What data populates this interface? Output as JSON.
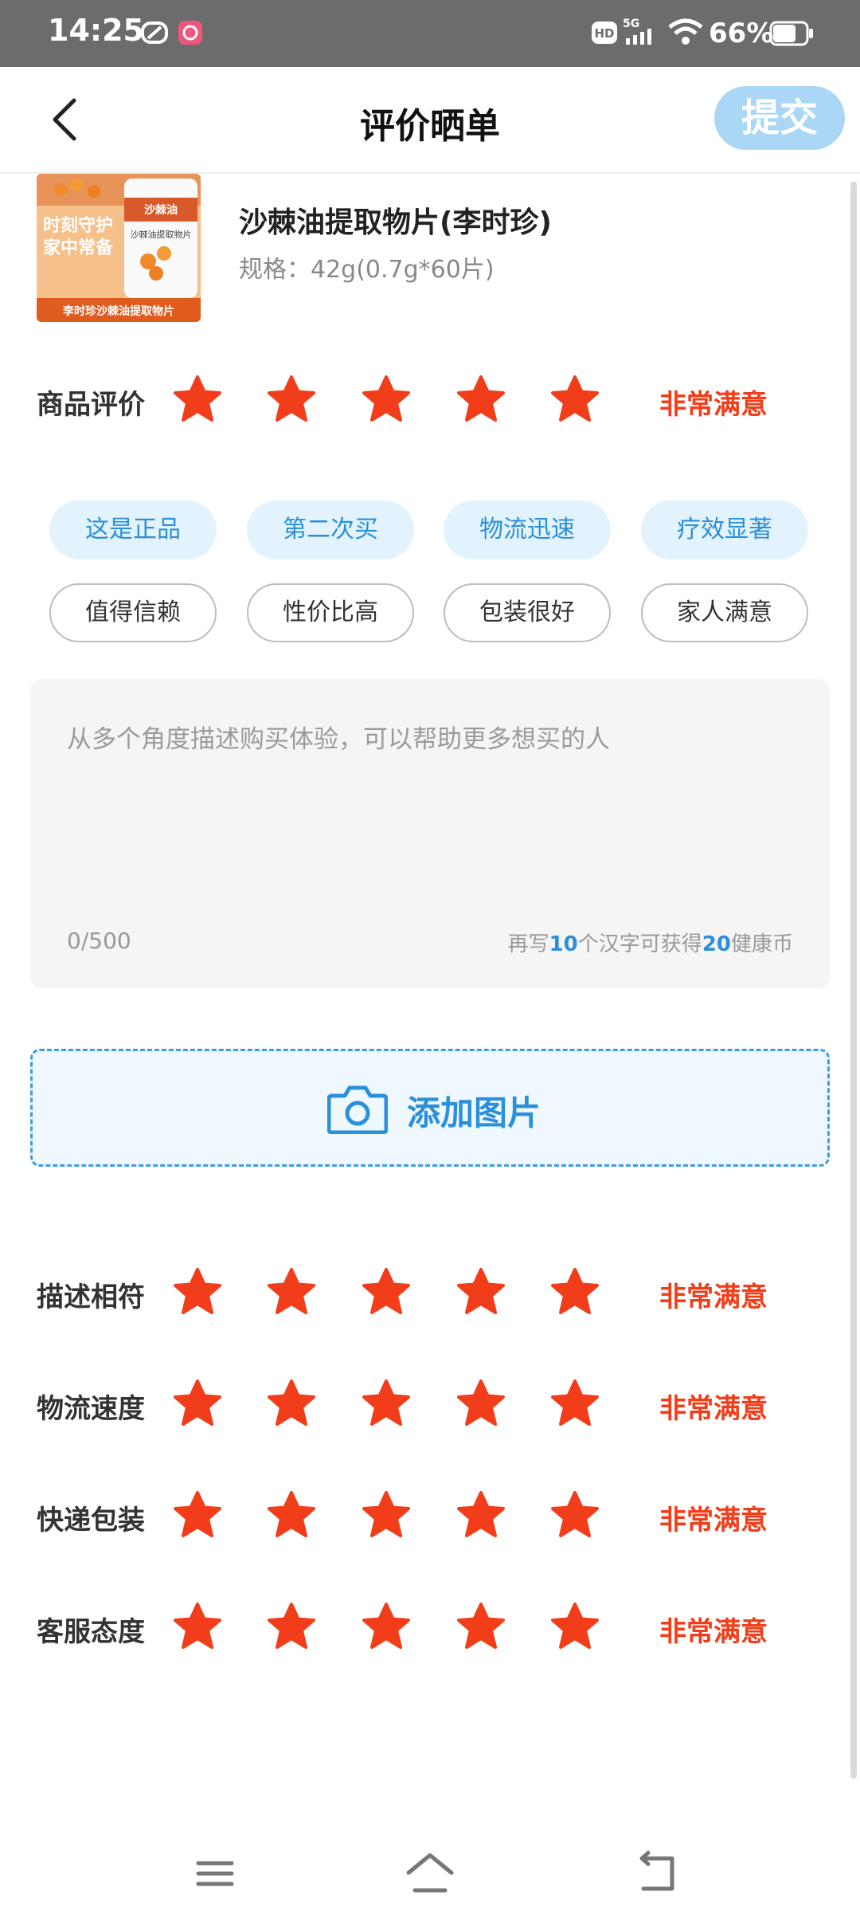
{
  "status_bar": {
    "time": "14:25",
    "network": "5G",
    "battery": "66%"
  },
  "header": {
    "title": "评价晒单",
    "submit_label": "提交"
  },
  "product": {
    "name": "沙棘油提取物片(李时珍)",
    "spec": "规格：42g(0.7g*60片)",
    "thumb_text_1": "时刻守护",
    "thumb_text_2": "家中常备",
    "thumb_badge": "沙棘油",
    "thumb_sub": "沙棘油提取物片",
    "thumb_bottom": "李时珍沙棘油提取物片"
  },
  "main_rating": {
    "label": "商品评价",
    "stars": 5,
    "max": 5,
    "text": "非常满意"
  },
  "tags": [
    {
      "label": "这是正品",
      "selected": true
    },
    {
      "label": "第二次买",
      "selected": true
    },
    {
      "label": "物流迅速",
      "selected": true
    },
    {
      "label": "疗效显著",
      "selected": true
    },
    {
      "label": "值得信赖",
      "selected": false
    },
    {
      "label": "性价比高",
      "selected": false
    },
    {
      "label": "包装很好",
      "selected": false
    },
    {
      "label": "家人满意",
      "selected": false
    }
  ],
  "comment": {
    "placeholder": "从多个角度描述购买体验，可以帮助更多想买的人",
    "counter": "0/500",
    "hint_prefix": "再写",
    "hint_num1": "10",
    "hint_mid": "个汉字可获得",
    "hint_num2": "20",
    "hint_suffix": "健康币"
  },
  "add_image": {
    "label": "添加图片"
  },
  "detail_ratings": [
    {
      "label": "描述相符",
      "stars": 5,
      "text": "非常满意"
    },
    {
      "label": "物流速度",
      "stars": 5,
      "text": "非常满意"
    },
    {
      "label": "快递包装",
      "stars": 5,
      "text": "非常满意"
    },
    {
      "label": "客服态度",
      "stars": 5,
      "text": "非常满意"
    }
  ],
  "colors": {
    "accent": "#2b8fd9",
    "star": "#f23d1a",
    "submit_bg": "#a9d7f5"
  }
}
